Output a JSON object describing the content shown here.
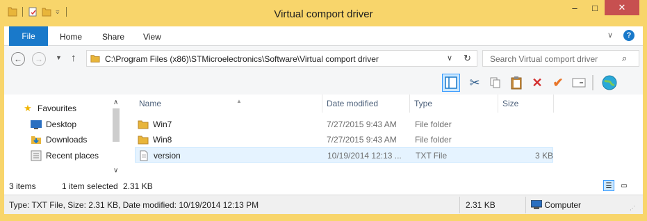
{
  "window": {
    "title": "Virtual comport driver",
    "minimize_glyph": "‒",
    "maximize_glyph": "□",
    "close_glyph": "✕",
    "frame_color": "#f8d56b",
    "close_color": "#c75050"
  },
  "ribbon": {
    "tabs": [
      {
        "label": "File"
      },
      {
        "label": "Home"
      },
      {
        "label": "Share"
      },
      {
        "label": "View"
      }
    ],
    "collapse_glyph": "∨",
    "help_glyph": "?"
  },
  "address_bar": {
    "path": "C:\\Program Files (x86)\\STMicroelectronics\\Software\\Virtual comport driver",
    "search_placeholder": "Search Virtual comport driver"
  },
  "toolbar": {
    "icons": [
      "preview-pane-icon",
      "cut-icon",
      "copy-icon",
      "paste-icon",
      "delete-icon",
      "properties-check-icon",
      "rename-icon",
      "globe-icon"
    ]
  },
  "nav_pane": {
    "items": [
      {
        "label": "Favourites",
        "icon": "star-icon"
      },
      {
        "label": "Desktop",
        "icon": "desktop-icon"
      },
      {
        "label": "Downloads",
        "icon": "downloads-icon"
      },
      {
        "label": "Recent places",
        "icon": "recent-places-icon"
      }
    ]
  },
  "file_list": {
    "columns": [
      "Name",
      "Date modified",
      "Type",
      "Size"
    ],
    "rows": [
      {
        "name": "Win7",
        "date": "7/27/2015 9:43 AM",
        "type": "File folder",
        "size": "",
        "icon": "folder-icon",
        "selected": false
      },
      {
        "name": "Win8",
        "date": "7/27/2015 9:43 AM",
        "type": "File folder",
        "size": "",
        "icon": "folder-icon",
        "selected": false
      },
      {
        "name": "version",
        "date": "10/19/2014 12:13 ...",
        "type": "TXT File",
        "size": "3 KB",
        "icon": "text-file-icon",
        "selected": true
      }
    ]
  },
  "info_bar": {
    "item_count": "3 items",
    "selection": "1 item selected",
    "selection_size": "2.31 KB"
  },
  "status_bar": {
    "details": "Type: TXT File, Size: 2.31 KB, Date modified: 10/19/2014 12:13 PM",
    "size": "2.31 KB",
    "location": "Computer"
  },
  "colors": {
    "accent": "#1979ca",
    "selection": "#cce8ff",
    "header_text": "#4c607a"
  }
}
